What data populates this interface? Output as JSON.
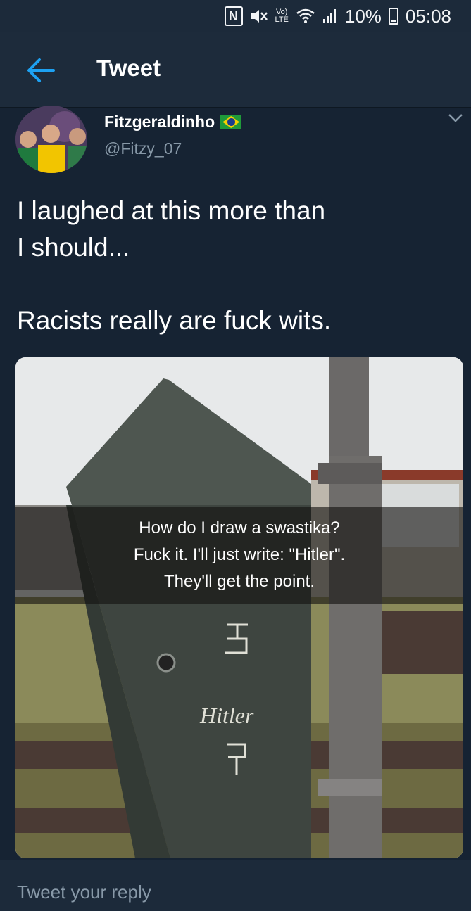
{
  "status_bar": {
    "battery": "10%",
    "time": "05:08",
    "nfc_label": "N",
    "volte_label": "Vo)\nLTE",
    "icons": [
      "nfc-icon",
      "mute-icon",
      "volte-icon",
      "wifi-icon",
      "signal-icon",
      "battery-icon"
    ]
  },
  "header": {
    "title": "Tweet",
    "back_icon": "arrow-left-icon"
  },
  "tweet": {
    "author_name": "Fitzgeraldinho",
    "author_handle": "@Fitzy_07",
    "flag": "brazil-flag-icon",
    "text": "I laughed at this more than\nI should...\n\nRacists really are fuck wits.",
    "caret_icon": "chevron-down-icon"
  },
  "media": {
    "caption_lines": [
      "How do I draw a swastika?",
      "Fuck it. I'll just write: \"Hitler\".",
      "They'll get the point."
    ],
    "graffiti_text": "Hitler"
  },
  "reply": {
    "placeholder": "Tweet your reply"
  },
  "colors": {
    "background": "#162333",
    "header": "#1d2b3b",
    "accent": "#1da1f2",
    "secondary_text": "#8899a8"
  }
}
